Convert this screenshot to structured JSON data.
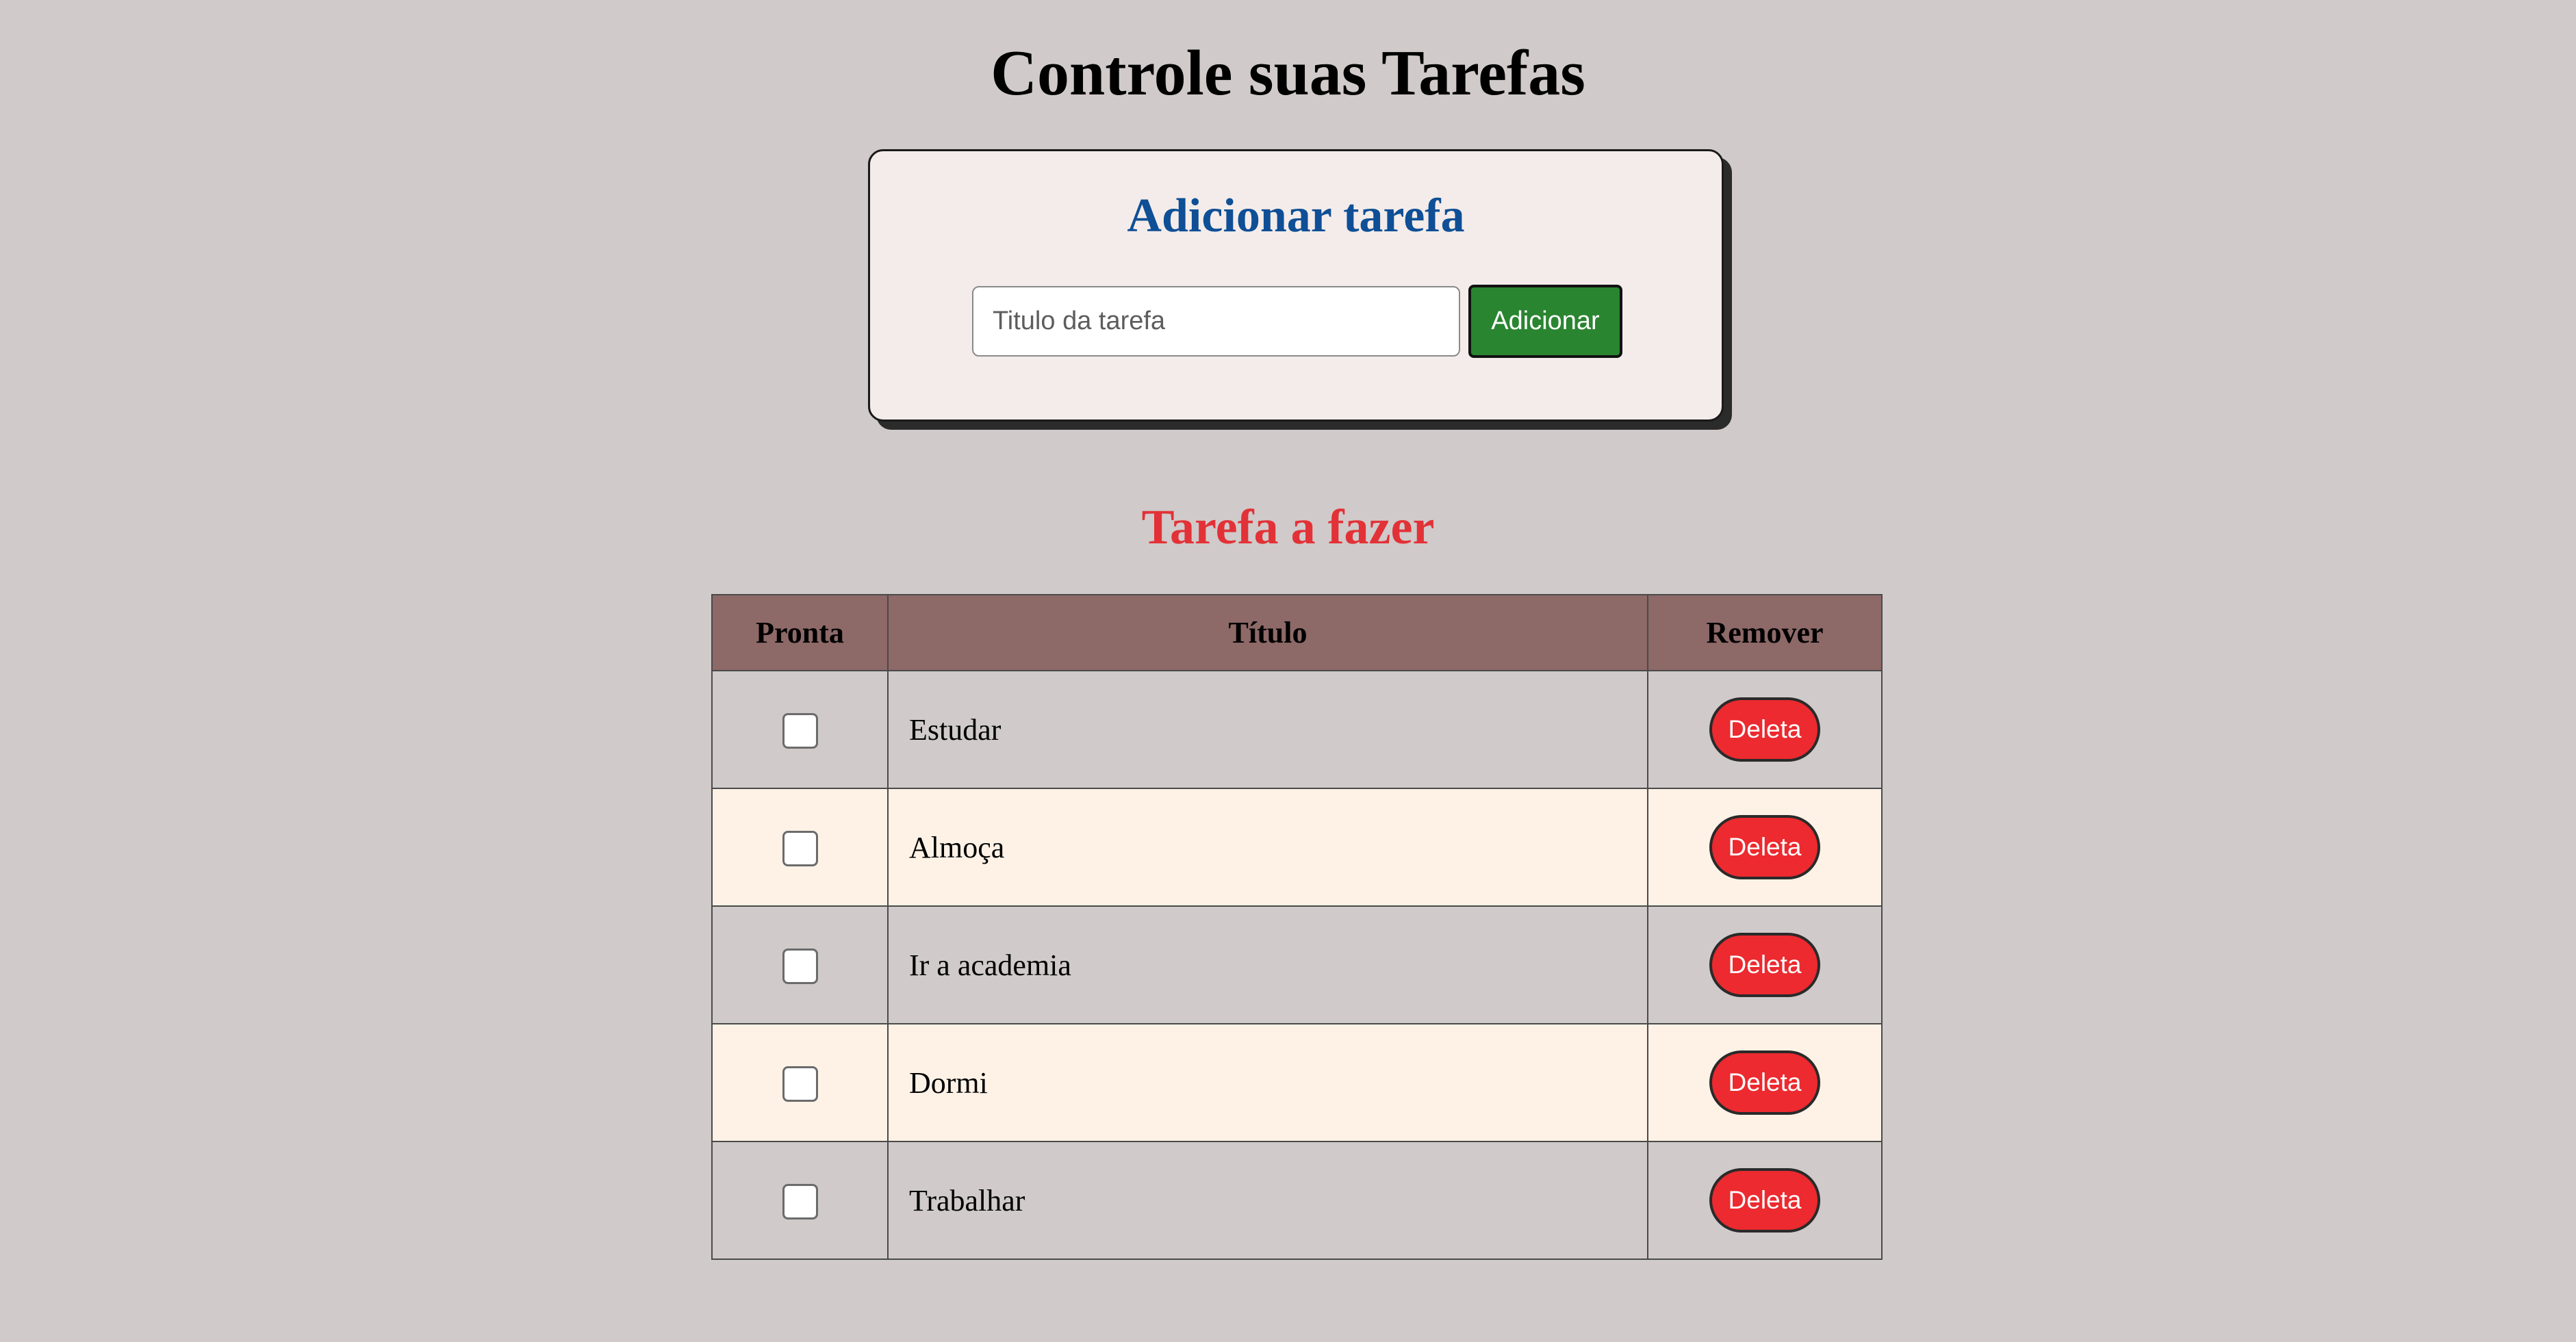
{
  "header": {
    "title": "Controle suas Tarefas"
  },
  "add_form": {
    "title": "Adicionar tarefa",
    "input_placeholder": "Titulo da tarefa",
    "input_value": "",
    "button_label": "Adicionar"
  },
  "task_list": {
    "title": "Tarefa a fazer",
    "columns": [
      "Pronta",
      "Título",
      "Remover"
    ],
    "delete_label": "Deleta",
    "tasks": [
      {
        "title": "Estudar",
        "done": false
      },
      {
        "title": "Almoça",
        "done": false
      },
      {
        "title": "Ir a academia",
        "done": false
      },
      {
        "title": "Dormi",
        "done": false
      },
      {
        "title": "Trabalhar",
        "done": false
      }
    ]
  },
  "colors": {
    "background": "#d0caca",
    "card_background": "#f4ecea",
    "card_title": "#0e4f96",
    "section_title": "#e23237",
    "add_button": "#2a8530",
    "delete_button": "#ec2a2f",
    "table_header": "#8d6968",
    "row_alt": "#fef2e6"
  }
}
